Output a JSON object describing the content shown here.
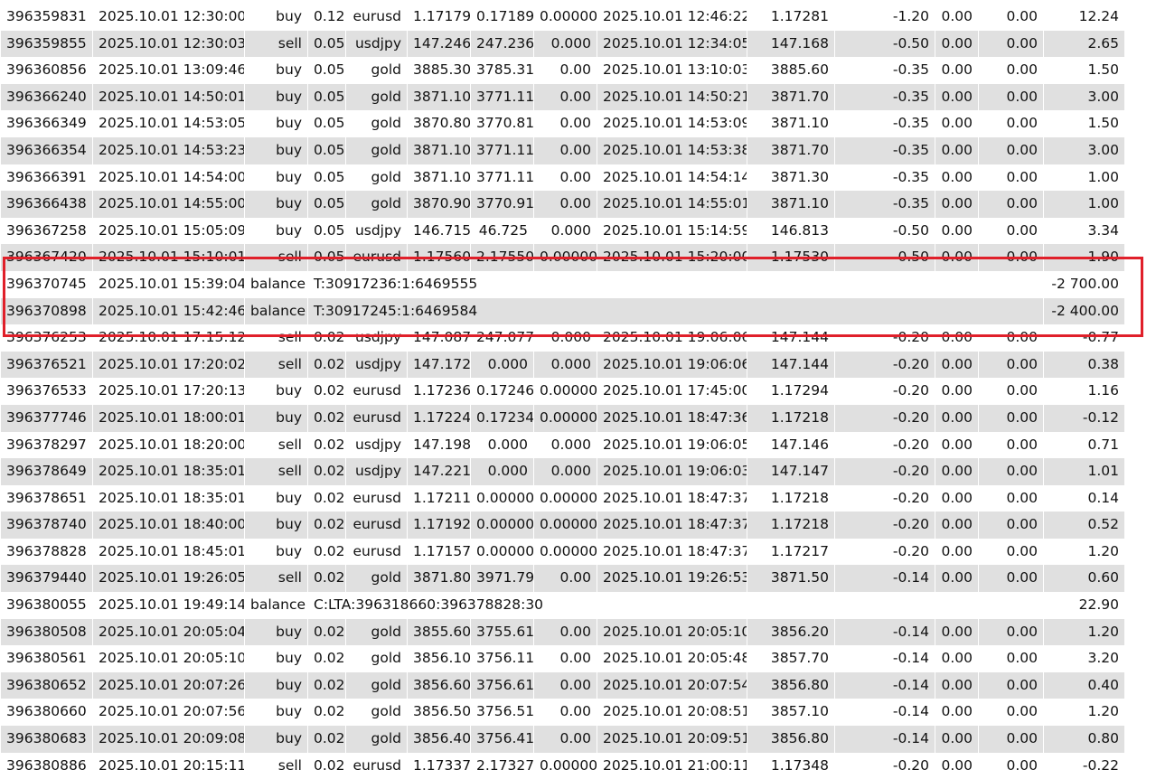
{
  "highlight_color": "#e0202a",
  "rows": [
    {
      "ticket": "396359831",
      "open_time": "2025.10.01 12:30:00",
      "type": "buy",
      "volume": "0.12",
      "symbol": "eurusd",
      "price": "1.17179",
      "sl": "0.17189",
      "tp": "0.00000",
      "close_time": "2025.10.01 12:46:22",
      "close_price": "1.17281",
      "commission": "-1.20",
      "taxes": "0.00",
      "swap": "0.00",
      "profit": "12.24"
    },
    {
      "ticket": "396359855",
      "open_time": "2025.10.01 12:30:03",
      "type": "sell",
      "volume": "0.05",
      "symbol": "usdjpy",
      "price": "147.246",
      "sl": "247.236",
      "tp": "0.000",
      "close_time": "2025.10.01 12:34:05",
      "close_price": "147.168",
      "commission": "-0.50",
      "taxes": "0.00",
      "swap": "0.00",
      "profit": "2.65"
    },
    {
      "ticket": "396360856",
      "open_time": "2025.10.01 13:09:46",
      "type": "buy",
      "volume": "0.05",
      "symbol": "gold",
      "price": "3885.30",
      "sl": "3785.31",
      "tp": "0.00",
      "close_time": "2025.10.01 13:10:03",
      "close_price": "3885.60",
      "commission": "-0.35",
      "taxes": "0.00",
      "swap": "0.00",
      "profit": "1.50"
    },
    {
      "ticket": "396366240",
      "open_time": "2025.10.01 14:50:01",
      "type": "buy",
      "volume": "0.05",
      "symbol": "gold",
      "price": "3871.10",
      "sl": "3771.11",
      "tp": "0.00",
      "close_time": "2025.10.01 14:50:21",
      "close_price": "3871.70",
      "commission": "-0.35",
      "taxes": "0.00",
      "swap": "0.00",
      "profit": "3.00"
    },
    {
      "ticket": "396366349",
      "open_time": "2025.10.01 14:53:05",
      "type": "buy",
      "volume": "0.05",
      "symbol": "gold",
      "price": "3870.80",
      "sl": "3770.81",
      "tp": "0.00",
      "close_time": "2025.10.01 14:53:09",
      "close_price": "3871.10",
      "commission": "-0.35",
      "taxes": "0.00",
      "swap": "0.00",
      "profit": "1.50"
    },
    {
      "ticket": "396366354",
      "open_time": "2025.10.01 14:53:23",
      "type": "buy",
      "volume": "0.05",
      "symbol": "gold",
      "price": "3871.10",
      "sl": "3771.11",
      "tp": "0.00",
      "close_time": "2025.10.01 14:53:38",
      "close_price": "3871.70",
      "commission": "-0.35",
      "taxes": "0.00",
      "swap": "0.00",
      "profit": "3.00"
    },
    {
      "ticket": "396366391",
      "open_time": "2025.10.01 14:54:00",
      "type": "buy",
      "volume": "0.05",
      "symbol": "gold",
      "price": "3871.10",
      "sl": "3771.11",
      "tp": "0.00",
      "close_time": "2025.10.01 14:54:14",
      "close_price": "3871.30",
      "commission": "-0.35",
      "taxes": "0.00",
      "swap": "0.00",
      "profit": "1.00"
    },
    {
      "ticket": "396366438",
      "open_time": "2025.10.01 14:55:00",
      "type": "buy",
      "volume": "0.05",
      "symbol": "gold",
      "price": "3870.90",
      "sl": "3770.91",
      "tp": "0.00",
      "close_time": "2025.10.01 14:55:01",
      "close_price": "3871.10",
      "commission": "-0.35",
      "taxes": "0.00",
      "swap": "0.00",
      "profit": "1.00"
    },
    {
      "ticket": "396367258",
      "open_time": "2025.10.01 15:05:09",
      "type": "buy",
      "volume": "0.05",
      "symbol": "usdjpy",
      "price": "146.715",
      "sl": "46.725",
      "tp": "0.000",
      "close_time": "2025.10.01 15:14:59",
      "close_price": "146.813",
      "commission": "-0.50",
      "taxes": "0.00",
      "swap": "0.00",
      "profit": "3.34"
    },
    {
      "ticket": "396367420",
      "open_time": "2025.10.01 15:10:01",
      "type": "sell",
      "volume": "0.05",
      "symbol": "eurusd",
      "price": "1.17560",
      "sl": "2.17550",
      "tp": "0.00000",
      "close_time": "2025.10.01 15:20:00",
      "close_price": "1.17530",
      "commission": "-0.50",
      "taxes": "0.00",
      "swap": "0.00",
      "profit": "1.90"
    },
    {
      "ticket": "396370745",
      "open_time": "2025.10.01 15:39:04",
      "type": "balance",
      "comment": "T:30917236:1:6469555",
      "profit": "-2 700.00"
    },
    {
      "ticket": "396370898",
      "open_time": "2025.10.01 15:42:46",
      "type": "balance",
      "comment": "T:30917245:1:6469584",
      "profit": "-2 400.00"
    },
    {
      "ticket": "396376253",
      "open_time": "2025.10.01 17:15:12",
      "type": "sell",
      "volume": "0.02",
      "symbol": "usdjpy",
      "price": "147.087",
      "sl": "247.077",
      "tp": "0.000",
      "close_time": "2025.10.01 19:06:06",
      "close_price": "147.144",
      "commission": "-0.20",
      "taxes": "0.00",
      "swap": "0.00",
      "profit": "-0.77"
    },
    {
      "ticket": "396376521",
      "open_time": "2025.10.01 17:20:02",
      "type": "sell",
      "volume": "0.02",
      "symbol": "usdjpy",
      "price": "147.172",
      "sl": "0.000",
      "tp": "0.000",
      "close_time": "2025.10.01 19:06:06",
      "close_price": "147.144",
      "commission": "-0.20",
      "taxes": "0.00",
      "swap": "0.00",
      "profit": "0.38"
    },
    {
      "ticket": "396376533",
      "open_time": "2025.10.01 17:20:13",
      "type": "buy",
      "volume": "0.02",
      "symbol": "eurusd",
      "price": "1.17236",
      "sl": "0.17246",
      "tp": "0.00000",
      "close_time": "2025.10.01 17:45:00",
      "close_price": "1.17294",
      "commission": "-0.20",
      "taxes": "0.00",
      "swap": "0.00",
      "profit": "1.16"
    },
    {
      "ticket": "396377746",
      "open_time": "2025.10.01 18:00:01",
      "type": "buy",
      "volume": "0.02",
      "symbol": "eurusd",
      "price": "1.17224",
      "sl": "0.17234",
      "tp": "0.00000",
      "close_time": "2025.10.01 18:47:36",
      "close_price": "1.17218",
      "commission": "-0.20",
      "taxes": "0.00",
      "swap": "0.00",
      "profit": "-0.12"
    },
    {
      "ticket": "396378297",
      "open_time": "2025.10.01 18:20:00",
      "type": "sell",
      "volume": "0.02",
      "symbol": "usdjpy",
      "price": "147.198",
      "sl": "0.000",
      "tp": "0.000",
      "close_time": "2025.10.01 19:06:05",
      "close_price": "147.146",
      "commission": "-0.20",
      "taxes": "0.00",
      "swap": "0.00",
      "profit": "0.71"
    },
    {
      "ticket": "396378649",
      "open_time": "2025.10.01 18:35:01",
      "type": "sell",
      "volume": "0.02",
      "symbol": "usdjpy",
      "price": "147.221",
      "sl": "0.000",
      "tp": "0.000",
      "close_time": "2025.10.01 19:06:03",
      "close_price": "147.147",
      "commission": "-0.20",
      "taxes": "0.00",
      "swap": "0.00",
      "profit": "1.01"
    },
    {
      "ticket": "396378651",
      "open_time": "2025.10.01 18:35:01",
      "type": "buy",
      "volume": "0.02",
      "symbol": "eurusd",
      "price": "1.17211",
      "sl": "0.00000",
      "tp": "0.00000",
      "close_time": "2025.10.01 18:47:37",
      "close_price": "1.17218",
      "commission": "-0.20",
      "taxes": "0.00",
      "swap": "0.00",
      "profit": "0.14"
    },
    {
      "ticket": "396378740",
      "open_time": "2025.10.01 18:40:00",
      "type": "buy",
      "volume": "0.02",
      "symbol": "eurusd",
      "price": "1.17192",
      "sl": "0.00000",
      "tp": "0.00000",
      "close_time": "2025.10.01 18:47:37",
      "close_price": "1.17218",
      "commission": "-0.20",
      "taxes": "0.00",
      "swap": "0.00",
      "profit": "0.52"
    },
    {
      "ticket": "396378828",
      "open_time": "2025.10.01 18:45:01",
      "type": "buy",
      "volume": "0.02",
      "symbol": "eurusd",
      "price": "1.17157",
      "sl": "0.00000",
      "tp": "0.00000",
      "close_time": "2025.10.01 18:47:37",
      "close_price": "1.17217",
      "commission": "-0.20",
      "taxes": "0.00",
      "swap": "0.00",
      "profit": "1.20"
    },
    {
      "ticket": "396379440",
      "open_time": "2025.10.01 19:26:05",
      "type": "sell",
      "volume": "0.02",
      "symbol": "gold",
      "price": "3871.80",
      "sl": "3971.79",
      "tp": "0.00",
      "close_time": "2025.10.01 19:26:53",
      "close_price": "3871.50",
      "commission": "-0.14",
      "taxes": "0.00",
      "swap": "0.00",
      "profit": "0.60"
    },
    {
      "ticket": "396380055",
      "open_time": "2025.10.01 19:49:14",
      "type": "balance",
      "comment": "C:LTA:396318660:396378828:30",
      "profit": "22.90"
    },
    {
      "ticket": "396380508",
      "open_time": "2025.10.01 20:05:04",
      "type": "buy",
      "volume": "0.02",
      "symbol": "gold",
      "price": "3855.60",
      "sl": "3755.61",
      "tp": "0.00",
      "close_time": "2025.10.01 20:05:10",
      "close_price": "3856.20",
      "commission": "-0.14",
      "taxes": "0.00",
      "swap": "0.00",
      "profit": "1.20"
    },
    {
      "ticket": "396380561",
      "open_time": "2025.10.01 20:05:10",
      "type": "buy",
      "volume": "0.02",
      "symbol": "gold",
      "price": "3856.10",
      "sl": "3756.11",
      "tp": "0.00",
      "close_time": "2025.10.01 20:05:48",
      "close_price": "3857.70",
      "commission": "-0.14",
      "taxes": "0.00",
      "swap": "0.00",
      "profit": "3.20"
    },
    {
      "ticket": "396380652",
      "open_time": "2025.10.01 20:07:26",
      "type": "buy",
      "volume": "0.02",
      "symbol": "gold",
      "price": "3856.60",
      "sl": "3756.61",
      "tp": "0.00",
      "close_time": "2025.10.01 20:07:54",
      "close_price": "3856.80",
      "commission": "-0.14",
      "taxes": "0.00",
      "swap": "0.00",
      "profit": "0.40"
    },
    {
      "ticket": "396380660",
      "open_time": "2025.10.01 20:07:56",
      "type": "buy",
      "volume": "0.02",
      "symbol": "gold",
      "price": "3856.50",
      "sl": "3756.51",
      "tp": "0.00",
      "close_time": "2025.10.01 20:08:51",
      "close_price": "3857.10",
      "commission": "-0.14",
      "taxes": "0.00",
      "swap": "0.00",
      "profit": "1.20"
    },
    {
      "ticket": "396380683",
      "open_time": "2025.10.01 20:09:08",
      "type": "buy",
      "volume": "0.02",
      "symbol": "gold",
      "price": "3856.40",
      "sl": "3756.41",
      "tp": "0.00",
      "close_time": "2025.10.01 20:09:51",
      "close_price": "3856.80",
      "commission": "-0.14",
      "taxes": "0.00",
      "swap": "0.00",
      "profit": "0.80"
    },
    {
      "ticket": "396380886",
      "open_time": "2025.10.01 20:15:11",
      "type": "sell",
      "volume": "0.02",
      "symbol": "eurusd",
      "price": "1.17337",
      "sl": "2.17327",
      "tp": "0.00000",
      "close_time": "2025.10.01 21:00:11",
      "close_price": "1.17348",
      "commission": "-0.20",
      "taxes": "0.00",
      "swap": "0.00",
      "profit": "-0.22"
    }
  ]
}
